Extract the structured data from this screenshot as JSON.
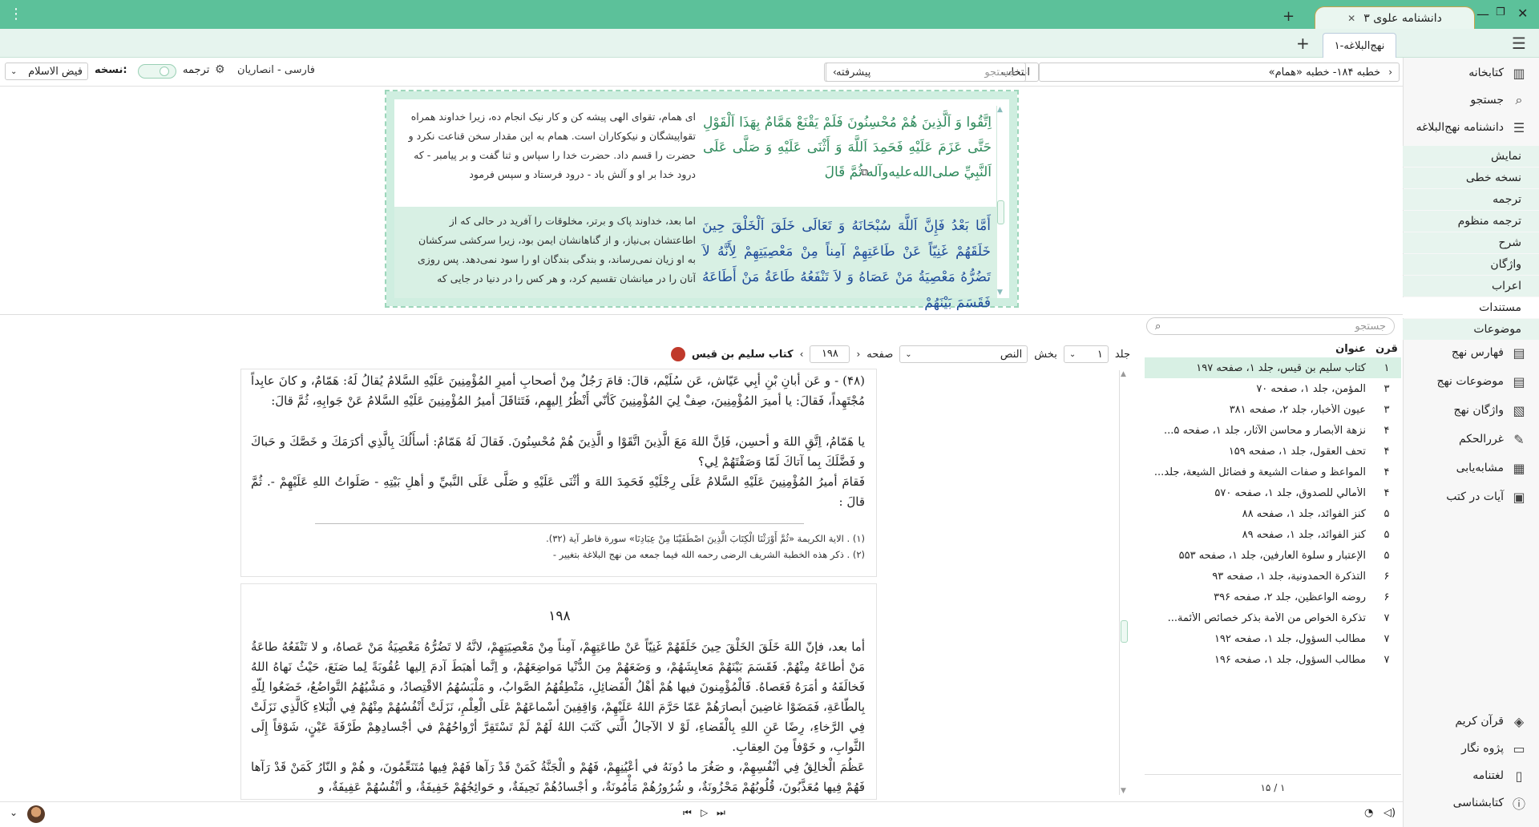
{
  "window": {
    "app_title": "دانشنامه علوی ۳",
    "menu_icon": "kebab-menu-icon",
    "minimize": "minimize-icon",
    "maximize": "maximize-icon",
    "close": "close-icon",
    "accent_color": "#5cc19a"
  },
  "doc_tab": {
    "label": "نهج‌البلاغه-۱"
  },
  "toolbar": {
    "breadcrumb": "خطبه ۱۸۴- خطبه «همام»",
    "select_label": "انتخاب",
    "search_placeholder": "جستجو",
    "advanced_label": "پیشرفته",
    "translation_select": "فارسی - انصاریان",
    "translation_label": "ترجمه",
    "version_label": "نسخه:",
    "version_value": "فیض الاسلام"
  },
  "sidebar": {
    "main": [
      {
        "label": "کتابخانه",
        "icon": "library-icon"
      },
      {
        "label": "جستجو",
        "icon": "search-icon"
      },
      {
        "label": "دانشنامه نهج‌البلاغه",
        "icon": "encyclopedia-icon"
      }
    ],
    "sub": [
      "نمایش",
      "نسخه خطی",
      "ترجمه",
      "ترجمه منظوم",
      "شرح",
      "واژگان",
      "اعراب",
      "مستندات",
      "موضوعات"
    ],
    "tools": [
      {
        "label": "فهارس نهج",
        "icon": "index-icon"
      },
      {
        "label": "موضوعات نهج",
        "icon": "topics-icon"
      },
      {
        "label": "واژگان نهج",
        "icon": "vocabulary-icon"
      },
      {
        "label": "غررالحکم",
        "icon": "ghurar-icon"
      },
      {
        "label": "مشابه‌یابی",
        "icon": "similar-icon"
      },
      {
        "label": "آیات در کتب",
        "icon": "verses-icon"
      }
    ],
    "bottom": [
      {
        "label": "قرآن کریم",
        "icon": "quran-icon"
      },
      {
        "label": "پژوه نگار",
        "icon": "notes-icon"
      },
      {
        "label": "لغتنامه",
        "icon": "dictionary-icon"
      },
      {
        "label": "کتابشناسی",
        "icon": "bibliography-icon"
      }
    ]
  },
  "reader": {
    "p1_arabic": "اِتَّقُوا وَ اَلَّذِينَ هُمْ مُحْسِنُونَ فَلَمْ يَقْنَعْ هَمَّامٌ بِهَذَا اَلْقَوْلِ حَتَّى عَزَمَ عَلَيْهِ فَحَمِدَ اَللَّهَ وَ أَثْنَى عَلَيْهِ وَ صَلَّى عَلَى اَلنَّبِيِّ صلى‌الله‌عليه‌وآله ثُمَّ قَالَ",
    "p1_persian": "ای همام، تقوای الهی پیشه کن و کار نیک انجام ده، زیرا خداوند همراه تقواپیشگان و نیکوکاران است. همام به این مقدار سخن قناعت نکرد و حضرت را قسم داد. حضرت خدا را سپاس و ثنا گفت و بر پیامبر - که درود خدا بر او و آلش باد - درود فرستاد و سپس فرمود",
    "p2_arabic": "أَمَّا بَعْدُ فَإِنَّ اَللَّهَ سُبْحَانَهُ وَ تَعَالَى خَلَقَ اَلْخَلْقَ حِينَ خَلَقَهُمْ غَنِيّاً عَنْ طَاعَتِهِمْ آمِناً مِنْ مَعْصِيَتِهِمْ لِأَنَّهُ لاَ تَضُرُّهُ مَعْصِيَةُ مَنْ عَصَاهُ وَ لاَ تَنْفَعُهُ طَاعَةُ مَنْ أَطَاعَهُ فَقَسَمَ بَيْنَهُمْ",
    "p2_persian": "اما بعد، خداوند پاک و برتر، مخلوقات را آفرید در حالی که از اطاعتشان بی‌نیاز، و از گناهانشان ایمن بود، زیرا سرکشی سرکشان به او زیان نمی‌رساند، و بندگی بندگان او را سود نمی‌دهد. پس روزی آنان را در میانشان تقسیم کرد، و هر کس را در دنیا در جایی که"
  },
  "book_toolbar": {
    "volume_label": "جلد",
    "volume_value": "۱",
    "section_label": "بخش",
    "section_value": "النص",
    "page_label": "صفحه",
    "page_value": "۱۹۸",
    "book_title": "کتاب سلیم بن قیس"
  },
  "book": {
    "para1": "(۴۸) - و عَن أبانِ بْنِ أبِي عَيّاش، عَن سُلَيْم، قالَ: قامَ رَجُلٌ مِنْ أصحابِ أميرِ المُؤْمِنِينَ عَلَيْهِ السَّلامُ يُقالُ لَهُ: هَمّامٌ، و كانَ عابِداً مُجْتَهِداً، فَقالَ: يا أميرَ المُؤْمِنِينَ، صِفْ لِيَ المُؤْمِنِينَ كَأنّي أَنْظُرُ اِليهِم، فَتَثاقَلَ أميرُ المُؤْمِنِينَ عَلَيْهِ السَّلامُ عَنْ جَوابِهِ، ثُمَّ قالَ:",
    "para2": "يا هَمّامُ، اِتَّقِ اللهَ و أحسِن، فَاِنَّ اللهَ مَعَ الَّذِينَ اتَّقَوْا و الَّذِينَ هُمْ مُحْسِنُونَ. فَقالَ لَهُ هَمّامٌ: أسأَلُكَ بِالَّذِي أكرَمَكَ و خَصَّكَ و حَباكَ و فَضَّلَكَ بِما آتاكَ لَمّا وَصَفْتَهُمْ لِي؟",
    "para3": "فَقامَ أميرُ المُؤْمِنِينَ عَلَيْهِ السَّلامُ عَلَى رِجْلَيْهِ فَحَمِدَ اللهَ و أثْنَى عَلَيْهِ و صَلَّى عَلَى النَّبيِّ و أهلِ بَيْتِهِ - صَلَواتُ اللهِ عَلَيْهِمْ -. ثُمَّ قالَ :",
    "fn1": "(۱) . الایة الکریمة «ثُمَّ أَوْرَثْنَا الْكِتَابَ الَّذِينَ اصْطَفَيْنَا مِنْ عِبَادِنَا» سورة فاطر آیة (۳۲).",
    "fn2": "(۲) . ذکر هذه الخطبة الشریف الرضی رحمه الله فیما جمعه من نهج البلاغة بتغییر -",
    "page_number": "۱۹۸",
    "para4": "أما بعد، فإنّ اللهَ خَلَقَ الخَلْقَ حِينَ خَلَقَهُمْ غَنِيّاً عَنْ طاعَتِهِمْ، آمِناً مِنْ مَعْصِيَتِهِمْ، لانَّهُ لا تَضُرُّهُ مَعْصِيَةُ مَنْ عَصاهُ، و لا تَنْفَعُهُ طاعَةُ مَنْ أطاعَهُ مِنْهُمْ. فَقَسَمَ بَيْنَهُمْ مَعايِشَهُمْ، و وَضَعَهُمْ مِنَ الدُّنْيا مَواضِعَهُمْ، و اِنَّما أهبَطَ آدمَ اِليها عُقُوبَةً لِما صَنَعَ، حَيْثُ نَهاهُ اللهُ فَخالَفَهُ و أمَرَهُ فَعَصاهُ. فَالْمُؤْمِنونَ فيها هُمْ أهْلُ الْفَضائِلِ، مَنْطِقُهُمُ الصَّوابُ، و مَلْبَسُهُمُ الاقْتِصادُ، و مَشْيُهُمُ التَّواضُعُ، خَضَعُوا لِلّهِ بِالطّاعَةِ، فَمَضَوْا غاضِينَ أبصارَهُمْ عَمّا حَرَّمَ اللهُ عَلَيْهِمْ، وَاقِفِينَ أسْماعَهُمْ عَلَى الْعِلْمِ، نَزَلَتْ أَنْفُسُهُمْ مِنْهُمْ فِي الْبَلاءِ كَالَّذِي نَزَلَتْ فِي الرَّخاءِ، رِضًا عَنِ اللهِ بِالْقَضاءِ، لَوْ لا الآجالُ الَّتي كَتَبَ اللهُ لَهُمْ لَمْ تَسْتَقِرَّ أرْواحُهُمْ في أجْسادِهِمْ طَرْفَةَ عَيْنٍ، شَوْقاً إِلَى الثَّوابِ، و خَوْفاً مِنَ العِقابِ.",
    "para5": "عَظُمَ الْخالِقُ فِي أنْفُسِهِمْ، و صَغُرَ ما دُونَهُ في أعْيُنِهِمْ، فَهُمْ و الْجَنَّةُ كَمَنْ قَدْ رَآها فَهُمْ فِيها مُتَنَعِّمُونَ، و هُمْ و النّارُ كَمَنْ قَدْ رَآها فَهُمْ فِيها مُعَذَّبُونَ، قُلُوبُهُمْ مَحْزُونَةٌ، و شُرُورُهُمْ مَأْمُونَةٌ، و أجْسادُهُمْ نَحِيفَةٌ، و حَوائِجُهُمْ خَفِيفَةٌ، و أنْفُسُهُمْ عَفِيفَةٌ، و"
  },
  "sources": {
    "search_placeholder": "جستجو",
    "col_century": "قرن",
    "col_title": "عنوان",
    "rows": [
      {
        "c": "۱",
        "t": "کتاب سلیم بن قیس، جلد ۱، صفحه ۱۹۷"
      },
      {
        "c": "۳",
        "t": "المؤمن، جلد ۱، صفحه ۷۰"
      },
      {
        "c": "۳",
        "t": "عیون الأخبار، جلد ۲، صفحه ۳۸۱"
      },
      {
        "c": "۴",
        "t": "نزهة الأبصار و محاسن الآثار، جلد ۱، صفحه ۵..."
      },
      {
        "c": "۴",
        "t": "تحف العقول، جلد ۱، صفحه ۱۵۹"
      },
      {
        "c": "۴",
        "t": "المواعظ و صفات الشیعة و فضائل الشیعة، جلد..."
      },
      {
        "c": "۴",
        "t": "الأمالي للصدوق، جلد ۱، صفحه ۵۷۰"
      },
      {
        "c": "۵",
        "t": "کنز الفوائد، جلد ۱، صفحه ۸۸"
      },
      {
        "c": "۵",
        "t": "کنز الفوائد، جلد ۱، صفحه ۸۹"
      },
      {
        "c": "۵",
        "t": "الإعتبار و سلوة العارفین، جلد ۱، صفحه ۵۵۳"
      },
      {
        "c": "۶",
        "t": "التذکرة الحمدونیة، جلد ۱، صفحه ۹۳"
      },
      {
        "c": "۶",
        "t": "روضه الواعظین، جلد ۲، صفحه ۳۹۶"
      },
      {
        "c": "۷",
        "t": "تذکرة الخواص من الأمة بذکر خصائص الأئمة..."
      },
      {
        "c": "۷",
        "t": "مطالب السؤول، جلد ۱، صفحه ۱۹۲"
      },
      {
        "c": "۷",
        "t": "مطالب السؤول، جلد ۱، صفحه ۱۹۶"
      }
    ],
    "pager": "۱ / ۱۵"
  }
}
